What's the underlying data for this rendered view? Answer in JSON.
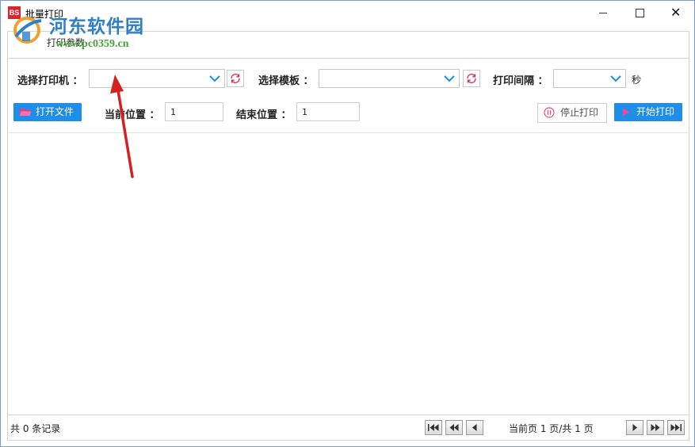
{
  "window": {
    "title": "批量打印",
    "icon_text": "BS"
  },
  "watermark": {
    "site_name": "河东软件园",
    "url": "www.pc0359.cn"
  },
  "tab": {
    "label": "打印参数"
  },
  "printer": {
    "label": "选择打印机 ：",
    "value": ""
  },
  "template": {
    "label": "选择模板 ：",
    "value": ""
  },
  "interval": {
    "label": "打印间隔 ：",
    "value": "",
    "unit": "秒"
  },
  "toolbar": {
    "open_file": "打开文件",
    "stop_print": "停止打印",
    "start_print": "开始打印",
    "current_pos_label": "当前位置 ：",
    "current_pos_value": "1",
    "end_pos_label": "结束位置 ：",
    "end_pos_value": "1"
  },
  "footer": {
    "record_count": "共 0 条记录",
    "page_info": "当前页 1 页/共 1 页"
  },
  "colors": {
    "accent": "#1e8ee8",
    "annotation_arrow": "#d42020",
    "refresh_icon": "#d8265a"
  }
}
